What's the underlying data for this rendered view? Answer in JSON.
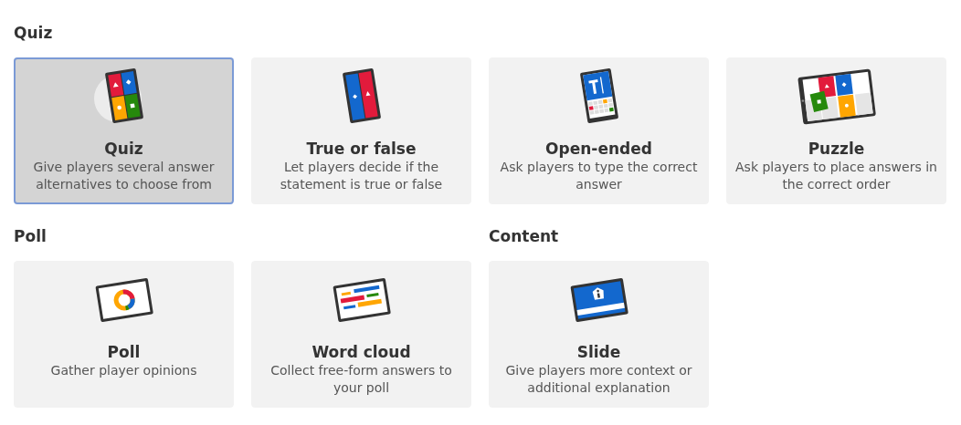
{
  "sections": [
    {
      "title": "Quiz",
      "items": [
        {
          "kind": "quiz",
          "title": "Quiz",
          "description": "Give players several answer alternatives to choose from",
          "selected": true
        },
        {
          "kind": "true_false",
          "title": "True or false",
          "description": "Let players decide if the statement is true or false",
          "selected": false
        },
        {
          "kind": "open_ended",
          "title": "Open-ended",
          "description": "Ask players to type the correct answer",
          "selected": false
        },
        {
          "kind": "puzzle",
          "title": "Puzzle",
          "description": "Ask players to place answers in the correct order",
          "selected": false
        }
      ]
    },
    {
      "title": "Poll",
      "items": [
        {
          "kind": "poll",
          "title": "Poll",
          "description": "Gather player opinions",
          "selected": false
        },
        {
          "kind": "word_cloud",
          "title": "Word cloud",
          "description": "Collect free-form answers to your poll",
          "selected": false
        }
      ]
    },
    {
      "title": "Content",
      "items": [
        {
          "kind": "slide",
          "title": "Slide",
          "description": "Give players more context or additional explanation",
          "selected": false
        }
      ]
    }
  ]
}
